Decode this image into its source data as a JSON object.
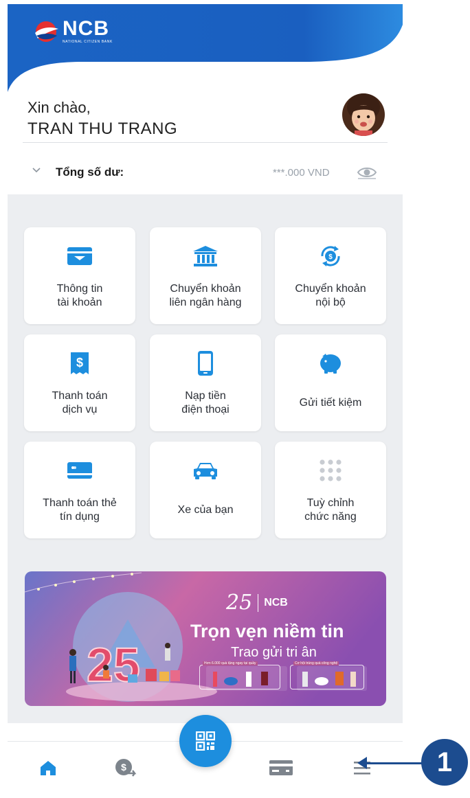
{
  "app": {
    "brand_name": "NCB",
    "brand_tagline": "NATIONAL CITIZEN BANK"
  },
  "greeting": {
    "hello": "Xin chào,",
    "name": "TRAN THU TRANG"
  },
  "balance": {
    "label": "Tổng số dư:",
    "value": "***.000 VND",
    "toggle_icon": "eye-icon",
    "expand_icon": "chevron-down-icon"
  },
  "features": [
    {
      "label": "Thông tin\ntài khoản",
      "icon": "account-info-icon"
    },
    {
      "label": "Chuyển khoản\nliên ngân hàng",
      "icon": "bank-icon"
    },
    {
      "label": "Chuyển khoản\nnội bộ",
      "icon": "internal-transfer-icon"
    },
    {
      "label": "Thanh toán\ndịch vụ",
      "icon": "bill-payment-icon"
    },
    {
      "label": "Nạp tiền\nđiện thoại",
      "icon": "phone-topup-icon"
    },
    {
      "label": "Gửi tiết kiệm",
      "icon": "piggy-bank-icon"
    },
    {
      "label": "Thanh toán thẻ\ntín dụng",
      "icon": "credit-card-icon"
    },
    {
      "label": "Xe của bạn",
      "icon": "car-icon"
    },
    {
      "label": "Tuỳ chỉnh\nchức năng",
      "icon": "grid-dots-icon"
    }
  ],
  "banner": {
    "brand_year": "25",
    "brand_name": "NCB",
    "title": "Trọn vẹn niềm tin",
    "subtitle": "Trao gửi tri ân",
    "badge_number": "25",
    "promo_left": "Hơn 6.000 quà tặng ngay tại quầy",
    "promo_right": "Cơ hội trúng quà công nghệ"
  },
  "bottom_nav": {
    "items": [
      {
        "icon": "home-icon"
      },
      {
        "icon": "money-transfer-icon"
      },
      {
        "icon": "qr-code-icon"
      },
      {
        "icon": "card-icon"
      },
      {
        "icon": "menu-icon"
      }
    ]
  },
  "callout": {
    "number": "1"
  },
  "colors": {
    "brand_blue": "#1565c0",
    "accent_blue": "#1d8ede",
    "grid_bg": "#eceef1",
    "callout": "#1c4c8f"
  }
}
